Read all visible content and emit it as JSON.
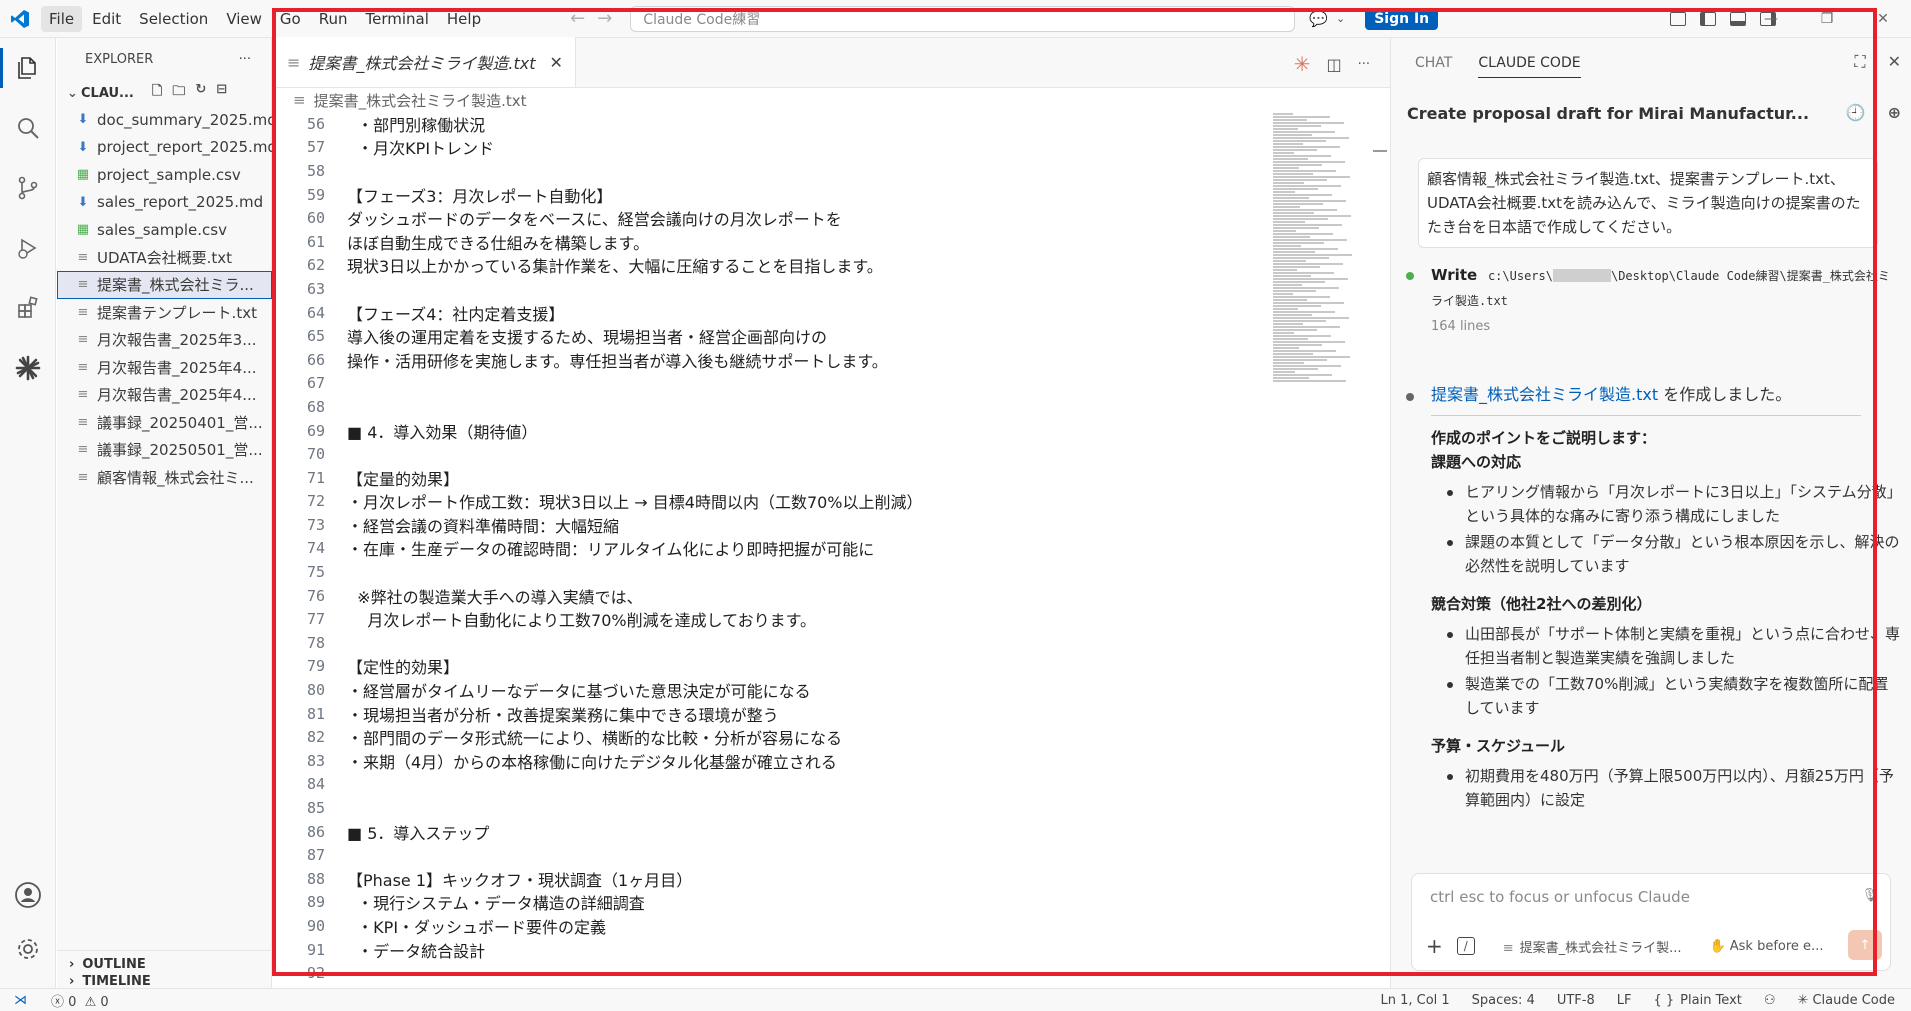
{
  "titlebar": {
    "menus": [
      "File",
      "Edit",
      "Selection",
      "View",
      "Go",
      "Run",
      "Terminal",
      "Help"
    ],
    "search_text": "Claude Code練習",
    "sign_in": "Sign In"
  },
  "sidebar": {
    "title": "EXPLORER",
    "more": "···",
    "folder": "CLAU...",
    "files": [
      {
        "name": "doc_summary_2025.md",
        "icon": "markdown-download-icon",
        "glyph": "⬇",
        "color": "#3b78c2"
      },
      {
        "name": "project_report_2025.md",
        "icon": "markdown-download-icon",
        "glyph": "⬇",
        "color": "#3b78c2"
      },
      {
        "name": "project_sample.csv",
        "icon": "csv-icon",
        "glyph": "▦",
        "color": "#4caf50"
      },
      {
        "name": "sales_report_2025.md",
        "icon": "markdown-download-icon",
        "glyph": "⬇",
        "color": "#3b78c2"
      },
      {
        "name": "sales_sample.csv",
        "icon": "csv-icon",
        "glyph": "▦",
        "color": "#4caf50"
      },
      {
        "name": "UDATA会社概要.txt",
        "icon": "text-file-icon",
        "glyph": "≡",
        "color": "#888888"
      },
      {
        "name": "提案書_株式会社ミラ...",
        "icon": "text-file-icon",
        "glyph": "≡",
        "color": "#888888",
        "selected": true
      },
      {
        "name": "提案書テンプレート.txt",
        "icon": "text-file-icon",
        "glyph": "≡",
        "color": "#888888"
      },
      {
        "name": "月次報告書_2025年3...",
        "icon": "text-file-icon",
        "glyph": "≡",
        "color": "#888888"
      },
      {
        "name": "月次報告書_2025年4...",
        "icon": "text-file-icon",
        "glyph": "≡",
        "color": "#888888"
      },
      {
        "name": "月次報告書_2025年4...",
        "icon": "text-file-icon",
        "glyph": "≡",
        "color": "#888888"
      },
      {
        "name": "議事録_20250401_営...",
        "icon": "text-file-icon",
        "glyph": "≡",
        "color": "#888888"
      },
      {
        "name": "議事録_20250501_営...",
        "icon": "text-file-icon",
        "glyph": "≡",
        "color": "#888888"
      },
      {
        "name": "顧客情報_株式会社ミ...",
        "icon": "text-file-icon",
        "glyph": "≡",
        "color": "#888888"
      }
    ],
    "outline": "OUTLINE",
    "timeline": "TIMELINE"
  },
  "editor": {
    "tab_label": "提案書_株式会社ミライ製造.txt",
    "breadcrumb": "提案書_株式会社ミライ製造.txt",
    "lines": [
      {
        "n": "56",
        "t": "  ・部門別稼働状況"
      },
      {
        "n": "57",
        "t": "  ・月次KPIトレンド"
      },
      {
        "n": "58",
        "t": ""
      },
      {
        "n": "59",
        "t": "【フェーズ3：月次レポート自動化】"
      },
      {
        "n": "60",
        "t": "ダッシュボードのデータをベースに、経営会議向けの月次レポートを"
      },
      {
        "n": "61",
        "t": "ほぼ自動生成できる仕組みを構築します。"
      },
      {
        "n": "62",
        "t": "現状3日以上かかっている集計作業を、大幅に圧縮することを目指します。"
      },
      {
        "n": "63",
        "t": ""
      },
      {
        "n": "64",
        "t": "【フェーズ4：社内定着支援】"
      },
      {
        "n": "65",
        "t": "導入後の運用定着を支援するため、現場担当者・経営企画部向けの"
      },
      {
        "n": "66",
        "t": "操作・活用研修を実施します。専任担当者が導入後も継続サポートします。"
      },
      {
        "n": "67",
        "t": ""
      },
      {
        "n": "68",
        "t": ""
      },
      {
        "n": "69",
        "t": "■ 4．導入効果（期待値）"
      },
      {
        "n": "70",
        "t": ""
      },
      {
        "n": "71",
        "t": "【定量的効果】"
      },
      {
        "n": "72",
        "t": "・月次レポート作成工数：現状3日以上 → 目標4時間以内（工数70%以上削減）"
      },
      {
        "n": "73",
        "t": "・経営会議の資料準備時間：大幅短縮"
      },
      {
        "n": "74",
        "t": "・在庫・生産データの確認時間：リアルタイム化により即時把握が可能に"
      },
      {
        "n": "75",
        "t": ""
      },
      {
        "n": "76",
        "t": "  ※弊社の製造業大手への導入実績では、"
      },
      {
        "n": "77",
        "t": "    月次レポート自動化により工数70%削減を達成しております。"
      },
      {
        "n": "78",
        "t": ""
      },
      {
        "n": "79",
        "t": "【定性的効果】"
      },
      {
        "n": "80",
        "t": "・経営層がタイムリーなデータに基づいた意思決定が可能になる"
      },
      {
        "n": "81",
        "t": "・現場担当者が分析・改善提案業務に集中できる環境が整う"
      },
      {
        "n": "82",
        "t": "・部門間のデータ形式統一により、横断的な比較・分析が容易になる"
      },
      {
        "n": "83",
        "t": "・来期（4月）からの本格稼働に向けたデジタル化基盤が確立される"
      },
      {
        "n": "84",
        "t": ""
      },
      {
        "n": "85",
        "t": ""
      },
      {
        "n": "86",
        "t": "■ 5．導入ステップ"
      },
      {
        "n": "87",
        "t": ""
      },
      {
        "n": "88",
        "t": "【Phase 1】キックオフ・現状調査（1ヶ月目）"
      },
      {
        "n": "89",
        "t": "  ・現行システム・データ構造の詳細調査"
      },
      {
        "n": "90",
        "t": "  ・KPI・ダッシュボード要件の定義"
      },
      {
        "n": "91",
        "t": "  ・データ統合設計"
      },
      {
        "n": "92",
        "t": ""
      }
    ]
  },
  "panel": {
    "tabs": [
      "CHAT",
      "CLAUDE CODE"
    ],
    "session_title": "Create proposal draft for Mirai Manufactur...",
    "user_message": "顧客情報_株式会社ミライ製造.txt、提案書テンプレート.txt、UDATA会社概要.txtを読み込んで、ミライ製造向けの提案書のたたき台を日本語で作成してください。",
    "tool": {
      "name": "Write",
      "path_prefix": "c:\\Users\\",
      "path_suffix": "\\Desktop\\Claude Code練習\\提案書_株式会社ミライ製造.txt",
      "meta": "164 lines"
    },
    "reply": {
      "link": "提案書_株式会社ミライ製造.txt",
      "link_suffix": " を作成しました。",
      "intro": "作成のポイントをご説明します：",
      "sections": [
        {
          "heading": "課題への対応",
          "items": [
            "ヒアリング情報から「月次レポートに3日以上」「システム分散」という具体的な痛みに寄り添う構成にしました",
            "課題の本質として「データ分散」という根本原因を示し、解決の必然性を説明しています"
          ]
        },
        {
          "heading": "競合対策（他社2社への差別化）",
          "items": [
            "山田部長が「サポート体制と実績を重視」という点に合わせ、専任担当者制と製造業実績を強調しました",
            "製造業での「工数70%削減」という実績数字を複数箇所に配置しています"
          ]
        },
        {
          "heading": "予算・スケジュール",
          "items": [
            "初期費用を480万円（予算上限500万円以内）、月額25万円（予算範囲内）に設定"
          ]
        }
      ]
    },
    "input_placeholder": "ctrl esc to focus or unfocus Claude",
    "attachment": "提案書_株式会社ミライ製...",
    "mode": "Ask before e..."
  },
  "statusbar": {
    "errors": "0",
    "warnings": "0",
    "position": "Ln 1, Col 1",
    "spaces": "Spaces: 4",
    "encoding": "UTF-8",
    "eol": "LF",
    "language": "Plain Text",
    "claude": "Claude Code"
  },
  "colors": {
    "accent": "#005fb8",
    "highlight": "#e8202a",
    "claude": "#d97757"
  }
}
